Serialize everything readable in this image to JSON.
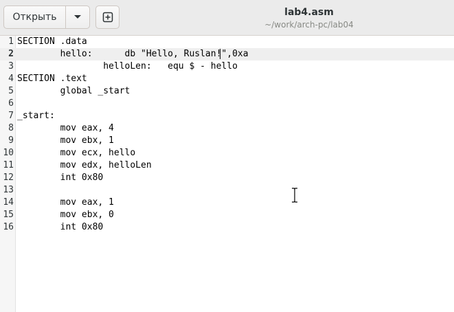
{
  "header": {
    "open_label": "Открыть",
    "title": "lab4.asm",
    "subtitle": "~/work/arch-pc/lab04"
  },
  "icons": {
    "dropdown": "chevron-down-icon",
    "new_tab": "new-tab-icon",
    "cursor": "text-cursor-icon"
  },
  "editor": {
    "current_line": 2,
    "lines": [
      {
        "num": "1",
        "text": "SECTION .data"
      },
      {
        "num": "2",
        "text": "        hello:      db \"Hello, Ruslan!\",0xa"
      },
      {
        "num": "3",
        "text": "                helloLen:   equ $ - hello"
      },
      {
        "num": "4",
        "text": "SECTION .text"
      },
      {
        "num": "5",
        "text": "        global _start"
      },
      {
        "num": "6",
        "text": ""
      },
      {
        "num": "7",
        "text": "_start:"
      },
      {
        "num": "8",
        "text": "        mov eax, 4"
      },
      {
        "num": "9",
        "text": "        mov ebx, 1"
      },
      {
        "num": "10",
        "text": "        mov ecx, hello"
      },
      {
        "num": "11",
        "text": "        mov edx, helloLen"
      },
      {
        "num": "12",
        "text": "        int 0x80"
      },
      {
        "num": "13",
        "text": ""
      },
      {
        "num": "14",
        "text": "        mov eax, 1"
      },
      {
        "num": "15",
        "text": "        mov ebx, 0"
      },
      {
        "num": "16",
        "text": "        int 0x80"
      }
    ]
  }
}
